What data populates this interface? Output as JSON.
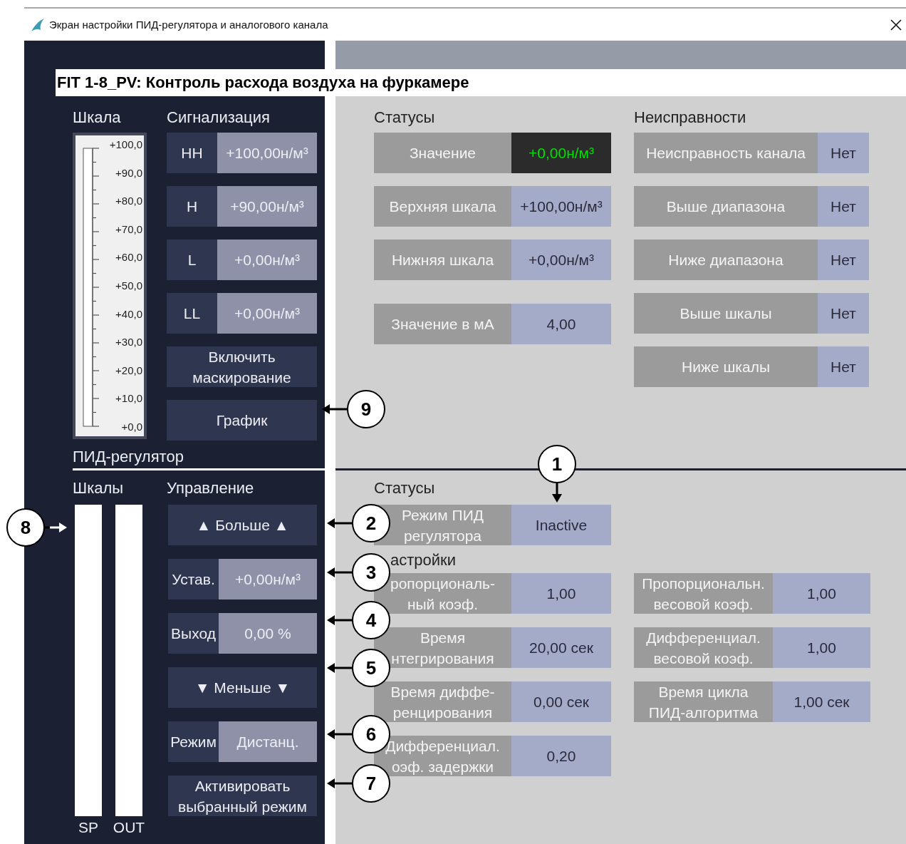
{
  "window": {
    "title": "Экран настройки ПИД-регулятора и аналогового канала"
  },
  "header": "FIT 1-8_PV: Контроль расхода воздуха на фуркамере",
  "analog": {
    "scale": {
      "heading": "Шкала",
      "ticks": [
        "+100,0",
        "+90,0",
        "+80,0",
        "+70,0",
        "+60,0",
        "+50,0",
        "+40,0",
        "+30,0",
        "+20,0",
        "+10,0",
        "+0,0"
      ]
    },
    "alarms": {
      "heading": "Сигнализация",
      "rows": [
        {
          "label": "HH",
          "value": "+100,00н/м³"
        },
        {
          "label": "H",
          "value": "+90,00н/м³"
        },
        {
          "label": "L",
          "value": "+0,00н/м³"
        },
        {
          "label": "LL",
          "value": "+0,00н/м³"
        }
      ],
      "buttons": [
        "Включить\nмаскирование",
        "График"
      ]
    },
    "statuses": {
      "heading": "Статусы",
      "rows": [
        {
          "label": "Значение",
          "value": "+0,00н/м³",
          "kind": "live"
        },
        {
          "label": "Верхняя шкала",
          "value": "+100,00н/м³",
          "kind": "plain"
        },
        {
          "label": "Нижняя шкала",
          "value": "+0,00н/м³",
          "kind": "plain"
        },
        {
          "label": "Значение в мА",
          "value": "4,00",
          "kind": "plain"
        }
      ]
    },
    "faults": {
      "heading": "Неисправности",
      "rows": [
        {
          "label": "Неисправность канала",
          "value": "Нет"
        },
        {
          "label": "Выше диапазона",
          "value": "Нет"
        },
        {
          "label": "Ниже диапазона",
          "value": "Нет"
        },
        {
          "label": "Выше шкалы",
          "value": "Нет"
        },
        {
          "label": "Ниже шкалы",
          "value": "Нет"
        }
      ]
    }
  },
  "pid": {
    "heading": "ПИД-регулятор",
    "bars": {
      "heading": "Шкалы",
      "items": [
        "SP",
        "OUT"
      ]
    },
    "control": {
      "heading": "Управление",
      "items": [
        {
          "kind": "button",
          "label": "▲ Больше ▲"
        },
        {
          "kind": "field",
          "label": "Устав.",
          "value": "+0,00н/м³"
        },
        {
          "kind": "field",
          "label": "Выход",
          "value": "0,00 %"
        },
        {
          "kind": "button",
          "label": "▼ Меньше ▼"
        },
        {
          "kind": "field",
          "label": "Режим",
          "value": "Дистанц."
        },
        {
          "kind": "button",
          "label": "Активировать\nвыбранный режим"
        }
      ]
    },
    "statuses": {
      "heading": "Статусы",
      "rows": [
        {
          "label": "Режим ПИД\nрегулятора",
          "value": "Inactive"
        }
      ]
    },
    "settings": {
      "heading": "астройки",
      "left": [
        {
          "label": "ропорциональ-\nный коэф.",
          "value": "1,00"
        },
        {
          "label": "Время\nнтегрирования",
          "value": "20,00 сек"
        },
        {
          "label": "Время диффе-\nренцирования",
          "value": "0,00 сек"
        },
        {
          "label": "Дифференциал.\nоэф. задержки",
          "value": "0,20"
        }
      ],
      "right": [
        {
          "label": "Пропорциональн.\nвесовой коэф.",
          "value": "1,00"
        },
        {
          "label": "Дифференциал.\nвесовой коэф.",
          "value": "1,00"
        },
        {
          "label": "Время цикла\nПИД-алгоритма",
          "value": "1,00 сек"
        }
      ]
    }
  },
  "callouts": [
    {
      "number": "1",
      "kind": "down"
    },
    {
      "number": "2",
      "kind": "left"
    },
    {
      "number": "3",
      "kind": "left"
    },
    {
      "number": "4",
      "kind": "left"
    },
    {
      "number": "5",
      "kind": "left"
    },
    {
      "number": "6",
      "kind": "left"
    },
    {
      "number": "7",
      "kind": "left"
    },
    {
      "number": "8",
      "kind": "right"
    },
    {
      "number": "9",
      "kind": "left"
    }
  ]
}
